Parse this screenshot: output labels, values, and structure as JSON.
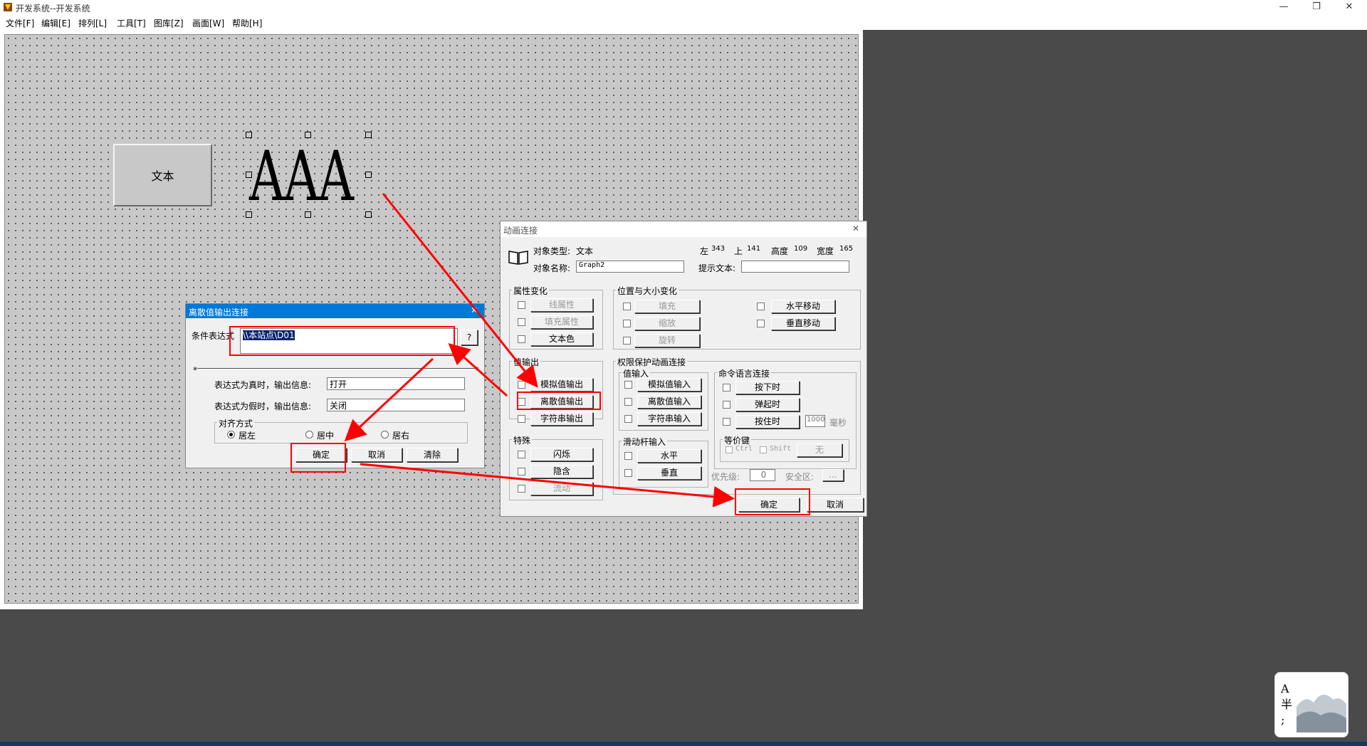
{
  "app": {
    "title": "开发系统--开发系统"
  },
  "menu": [
    "文件[F]",
    "编辑[E]",
    "排列[L]",
    "工具[T]",
    "图库[Z]",
    "画面[W]",
    "帮助[H]"
  ],
  "window_controls": {
    "minimize": "—",
    "restore": "❐",
    "close": "✕"
  },
  "canvas": {
    "button_text": "文本",
    "big_text": "AAA"
  },
  "discrete_dialog": {
    "title": "离散值输出连接",
    "condition_label": "条件表达式",
    "condition_value": "\\\\本站点\\D01",
    "help_button": "?",
    "separator_left": "*",
    "separator_right": "*",
    "true_label": "表达式为真时，输出信息:",
    "true_value": "打开",
    "false_label": "表达式为假时，输出信息:",
    "false_value": "关闭",
    "align_group": "对齐方式",
    "align_left": "居左",
    "align_center": "居中",
    "align_right": "居右",
    "ok": "确定",
    "cancel": "取消",
    "clear": "清除"
  },
  "anim_dialog": {
    "title": "动画连接",
    "object_type_label": "对象类型:",
    "object_type_value": "文本",
    "left_label": "左",
    "left_value": "343",
    "top_label": "上",
    "top_value": "141",
    "height_label": "高度",
    "height_value": "109",
    "width_label": "宽度",
    "width_value": "165",
    "object_name_label": "对象名称:",
    "object_name_value": "Graph2",
    "hint_label": "提示文本:",
    "hint_value": "",
    "attr_group": "属性变化",
    "attr_items": [
      "线属性",
      "填充属性",
      "文本色"
    ],
    "pos_group": "位置与大小变化",
    "pos_items": [
      "填充",
      "缩放",
      "旋转"
    ],
    "move_items": [
      "水平移动",
      "垂直移动"
    ],
    "output_group": "值输出",
    "output_items": [
      "模拟值输出",
      "离散值输出",
      "字符串输出"
    ],
    "perm_group": "权限保护动画连接",
    "input_group": "值输入",
    "input_items": [
      "模拟值输入",
      "离散值输入",
      "字符串输入"
    ],
    "cmd_group": "命令语言连接",
    "cmd_items": [
      "按下时",
      "弹起时",
      "按住时"
    ],
    "hold_ms_value": "1000",
    "hold_ms_unit": "毫秒",
    "equiv_group": "等价键",
    "ctrl_label": "Ctrl",
    "shift_label": "Shift",
    "equiv_button": "无",
    "special_group": "特殊",
    "special_items": [
      "闪烁",
      "隐含",
      "流动"
    ],
    "slider_group": "滑动杆输入",
    "slider_items": [
      "水平",
      "垂直"
    ],
    "priority_label": "优先级:",
    "priority_value": "0",
    "security_label": "安全区:",
    "security_button": "...",
    "ok": "确定",
    "cancel": "取消"
  },
  "watermark": {
    "text": "A 半 ;"
  },
  "colors": {
    "highlight": "#ff0000",
    "dialog_title": "#0078d7",
    "desktop": "#4a4a4a"
  }
}
